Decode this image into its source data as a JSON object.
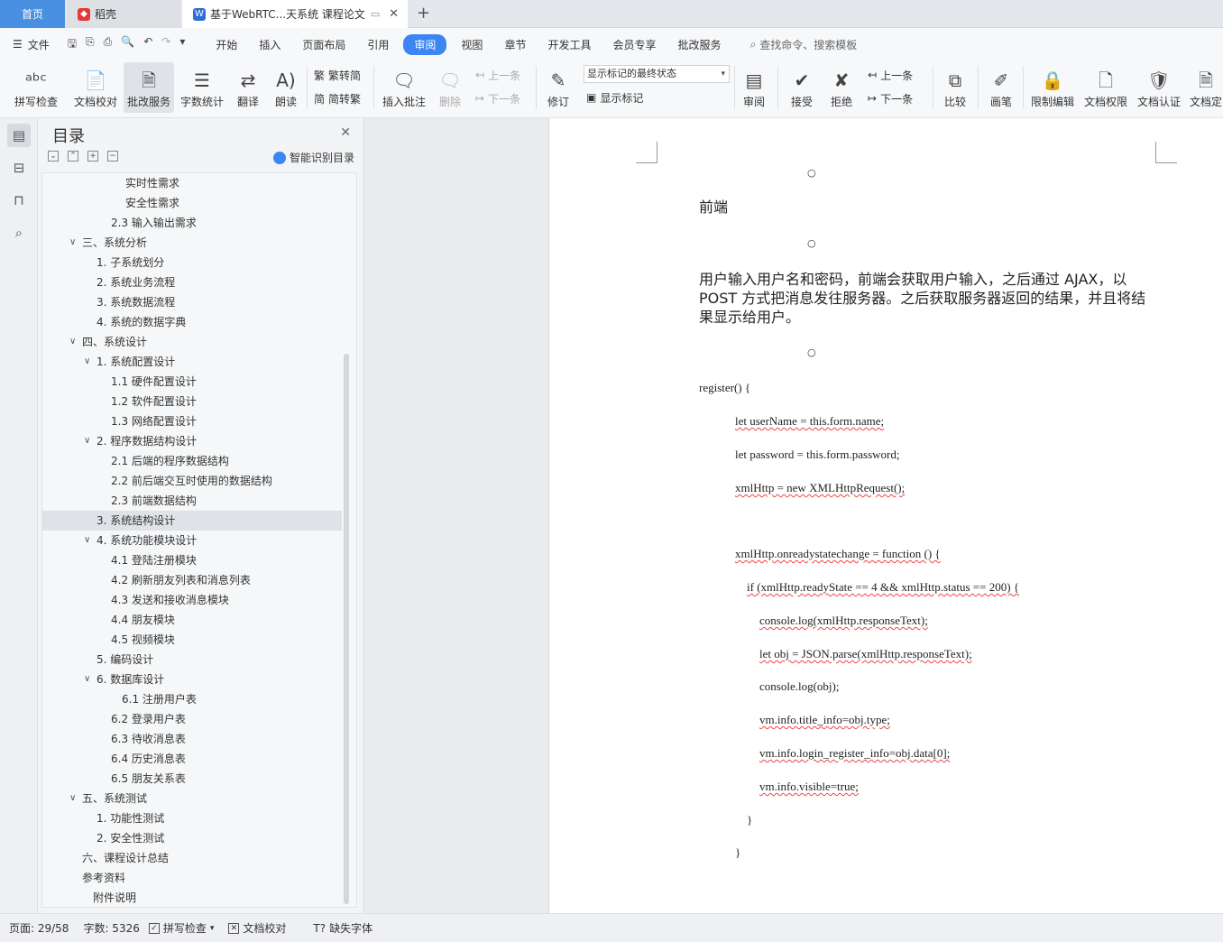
{
  "tabs": {
    "home": "首页",
    "daoke": "稻壳",
    "doc": "基于WebRTC...天系统 课程论文"
  },
  "menubar": {
    "file": "文件",
    "items": [
      "开始",
      "插入",
      "页面布局",
      "引用",
      "审阅",
      "视图",
      "章节",
      "开发工具",
      "会员专享",
      "批改服务"
    ],
    "active": "审阅",
    "search": "查找命令、搜索模板"
  },
  "ribbon": {
    "spell": "拼写检查",
    "proof": "文档校对",
    "correct": "批改服务",
    "wordcount": "字数统计",
    "translate": "翻译",
    "read": "朗读",
    "trad": "繁转简",
    "simp": "简转繁",
    "insert_comment": "插入批注",
    "delete": "删除",
    "prev": "上一条",
    "next": "下一条",
    "revise": "修订",
    "markup_state": "显示标记的最终状态",
    "show_markup": "显示标记",
    "review": "审阅",
    "accept": "接受",
    "reject": "拒绝",
    "prev2": "上一条",
    "next2": "下一条",
    "compare": "比较",
    "pen": "画笔",
    "restrict": "限制编辑",
    "perm": "文档权限",
    "cert": "文档认证",
    "final": "文档定"
  },
  "toc": {
    "title": "目录",
    "smart": "智能识别目录",
    "items": [
      "实时性需求",
      "安全性需求",
      "2.3 输入输出需求",
      "三、系统分析",
      "1. 子系统划分",
      "2. 系统业务流程",
      "3. 系统数据流程",
      "4. 系统的数据字典",
      "四、系统设计",
      "1. 系统配置设计",
      "1.1 硬件配置设计",
      "1.2 软件配置设计",
      "1.3 网络配置设计",
      "2. 程序数据结构设计",
      "2.1 后端的程序数据结构",
      "2.2 前后端交互时使用的数据结构",
      "2.3 前端数据结构",
      "3. 系统结构设计",
      "4. 系统功能模块设计",
      "4.1 登陆注册模块",
      "4.2 刷新朋友列表和消息列表",
      "4.3 发送和接收消息模块",
      "4.4 朋友模块",
      "4.5 视频模块",
      "5. 编码设计",
      "6. 数据库设计",
      "6.1 注册用户表",
      "6.2 登录用户表",
      "6.3 待收消息表",
      "6.4 历史消息表",
      "6.5 朋友关系表",
      "五、系统测试",
      "1. 功能性测试",
      "2. 安全性测试",
      "六、课程设计总结",
      "参考资料",
      "附件说明"
    ]
  },
  "doc": {
    "bullet": "○",
    "heading": "前端",
    "paragraph": "用户输入用户名和密码，前端会获取用户输入，之后通过 AJAX，以 POST 方式把消息发往服务器。之后获取服务器返回的结果，并且将结果显示给用户。",
    "code": {
      "l1": "register() {",
      "l2": "let userName = this.form.name;",
      "l3": "let password = this.form.password;",
      "l4": "xmlHttp = new XMLHttpRequest();",
      "l5": "xmlHttp.onreadystatechange = function () {",
      "l6": "if (xmlHttp.readyState == 4 && xmlHttp.status == 200) {",
      "l7": "console.log(xmlHttp.responseText);",
      "l8": "let obj = JSON.parse(xmlHttp.responseText);",
      "l9": "console.log(obj);",
      "l10": "vm.info.title_info=obj.type;",
      "l11": "vm.info.login_register_info=obj.data[0];",
      "l12": "vm.info.visible=true;",
      "l13": "}",
      "l14": "}"
    }
  },
  "status": {
    "page": "页面: 29/58",
    "words": "字数: 5326",
    "spell": "拼写检查",
    "proof": "文档校对",
    "font": "缺失字体"
  }
}
